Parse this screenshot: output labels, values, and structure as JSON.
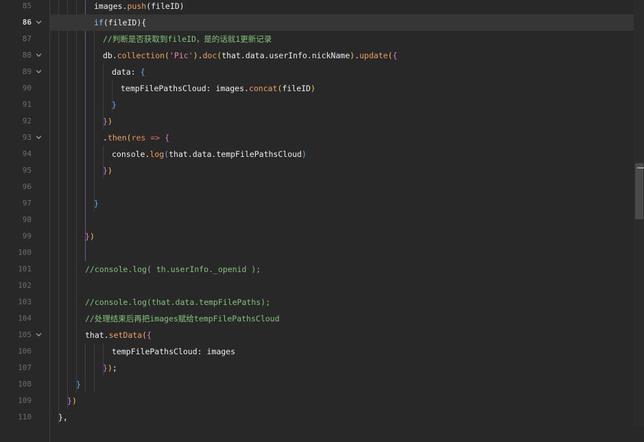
{
  "editor": {
    "current_line": "86",
    "lines": [
      {
        "num": "85",
        "fold": false,
        "tokens": [
          {
            "t": "images",
            "c": "prop"
          },
          {
            "t": ".",
            "c": "prop"
          },
          {
            "t": "push",
            "c": "fn"
          },
          {
            "t": "(",
            "c": "prop"
          },
          {
            "t": "fileID",
            "c": "prop"
          },
          {
            "t": ")",
            "c": "prop"
          }
        ]
      },
      {
        "num": "86",
        "fold": true,
        "tokens": [
          {
            "t": "if",
            "c": "kw"
          },
          {
            "t": "(fileID){",
            "c": "prop"
          }
        ]
      },
      {
        "num": "87",
        "fold": false,
        "tokens": [
          {
            "t": "//判断是否获取到fileID，是的话就1更新记录",
            "c": "cm"
          }
        ]
      },
      {
        "num": "88",
        "fold": true,
        "tokens": [
          {
            "t": "db.",
            "c": "prop"
          },
          {
            "t": "collection",
            "c": "fn"
          },
          {
            "t": "(",
            "c": "br1"
          },
          {
            "t": "'Pic'",
            "c": "str"
          },
          {
            "t": ")",
            "c": "br1"
          },
          {
            "t": ".",
            "c": "prop"
          },
          {
            "t": "doc",
            "c": "fn"
          },
          {
            "t": "(",
            "c": "br1"
          },
          {
            "t": "that.data.userInfo.nickName",
            "c": "prop"
          },
          {
            "t": ")",
            "c": "br1"
          },
          {
            "t": ".",
            "c": "prop"
          },
          {
            "t": "update",
            "c": "fn"
          },
          {
            "t": "(",
            "c": "br1"
          },
          {
            "t": "{",
            "c": "br2"
          }
        ]
      },
      {
        "num": "89",
        "fold": true,
        "tokens": [
          {
            "t": "data",
            "c": "prop"
          },
          {
            "t": ": ",
            "c": "prop"
          },
          {
            "t": "{",
            "c": "br3"
          }
        ]
      },
      {
        "num": "90",
        "fold": false,
        "tokens": [
          {
            "t": "tempFilePathsCloud",
            "c": "prop"
          },
          {
            "t": ": images.",
            "c": "prop"
          },
          {
            "t": "concat",
            "c": "fn"
          },
          {
            "t": "(",
            "c": "br1"
          },
          {
            "t": "fileID",
            "c": "prop"
          },
          {
            "t": ")",
            "c": "br1"
          }
        ]
      },
      {
        "num": "91",
        "fold": false,
        "tokens": [
          {
            "t": "}",
            "c": "br3"
          }
        ]
      },
      {
        "num": "92",
        "fold": false,
        "tokens": [
          {
            "t": "}",
            "c": "br2"
          },
          {
            "t": ")",
            "c": "br1"
          }
        ]
      },
      {
        "num": "93",
        "fold": true,
        "tokens": [
          {
            "t": ".",
            "c": "prop"
          },
          {
            "t": "then",
            "c": "fn"
          },
          {
            "t": "(",
            "c": "br1"
          },
          {
            "t": "res",
            "c": "param"
          },
          {
            "t": " ",
            "c": "prop"
          },
          {
            "t": "=>",
            "c": "op"
          },
          {
            "t": " ",
            "c": "prop"
          },
          {
            "t": "{",
            "c": "br2"
          }
        ]
      },
      {
        "num": "94",
        "fold": false,
        "tokens": [
          {
            "t": "console.",
            "c": "prop"
          },
          {
            "t": "log",
            "c": "fn"
          },
          {
            "t": "(",
            "c": "br3"
          },
          {
            "t": "that.data.tempFilePathsCloud",
            "c": "prop"
          },
          {
            "t": ")",
            "c": "br3"
          }
        ]
      },
      {
        "num": "95",
        "fold": false,
        "tokens": [
          {
            "t": "}",
            "c": "br2"
          },
          {
            "t": ")",
            "c": "br1"
          }
        ]
      },
      {
        "num": "96",
        "fold": false,
        "tokens": []
      },
      {
        "num": "97",
        "fold": false,
        "tokens": [
          {
            "t": "}",
            "c": "br3"
          }
        ]
      },
      {
        "num": "98",
        "fold": false,
        "tokens": []
      },
      {
        "num": "99",
        "fold": false,
        "tokens": [
          {
            "t": "}",
            "c": "br2"
          },
          {
            "t": ")",
            "c": "br1"
          }
        ]
      },
      {
        "num": "100",
        "fold": false,
        "tokens": []
      },
      {
        "num": "101",
        "fold": false,
        "tokens": [
          {
            "t": "//console.log( th.userInfo._openid );",
            "c": "cm"
          }
        ]
      },
      {
        "num": "102",
        "fold": false,
        "tokens": []
      },
      {
        "num": "103",
        "fold": false,
        "tokens": [
          {
            "t": "//console.log(that.data.tempFilePaths);",
            "c": "cm"
          }
        ]
      },
      {
        "num": "104",
        "fold": false,
        "tokens": [
          {
            "t": "//处理结束后再把images赋给tempFilePathsCloud",
            "c": "cm"
          }
        ]
      },
      {
        "num": "105",
        "fold": true,
        "tokens": [
          {
            "t": "that.",
            "c": "prop"
          },
          {
            "t": "setData",
            "c": "fn"
          },
          {
            "t": "(",
            "c": "br1"
          },
          {
            "t": "{",
            "c": "br2"
          }
        ]
      },
      {
        "num": "106",
        "fold": false,
        "tokens": [
          {
            "t": "tempFilePathsCloud",
            "c": "prop"
          },
          {
            "t": ": images",
            "c": "prop"
          }
        ]
      },
      {
        "num": "107",
        "fold": false,
        "tokens": [
          {
            "t": "}",
            "c": "br2"
          },
          {
            "t": ")",
            "c": "br1"
          },
          {
            "t": ";",
            "c": "prop"
          }
        ]
      },
      {
        "num": "108",
        "fold": false,
        "tokens": [
          {
            "t": "}",
            "c": "br3"
          }
        ]
      },
      {
        "num": "109",
        "fold": false,
        "tokens": [
          {
            "t": "}",
            "c": "br2"
          },
          {
            "t": ")",
            "c": "br1"
          }
        ]
      },
      {
        "num": "110",
        "fold": false,
        "tokens": [
          {
            "t": "},",
            "c": "prop"
          }
        ]
      }
    ]
  },
  "colors": {
    "background": "#282828",
    "current_line": "#363636",
    "keyword": "#7ec7ff",
    "function": "#f0a060",
    "string": "#e98aa2",
    "comment": "#84c47a"
  },
  "icons": {
    "fold": "chevron-down-icon"
  }
}
